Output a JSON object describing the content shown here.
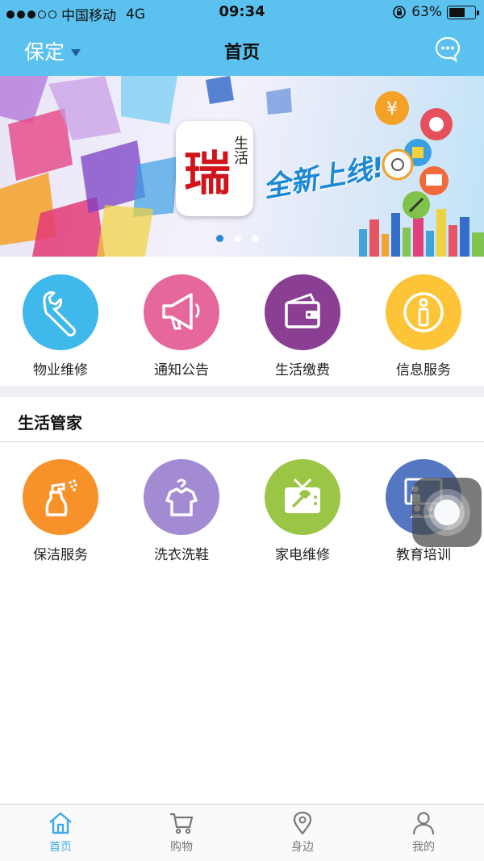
{
  "status_bar": {
    "carrier": "中国移动",
    "network": "4G",
    "time": "09:34",
    "battery": "63%",
    "battery_level": 0.63
  },
  "nav": {
    "city": "保定",
    "title": "首页",
    "chat_icon": "chat-bubble-icon"
  },
  "banner": {
    "logo_main": "瑞",
    "logo_side": "生活",
    "slogan": "全新上线!",
    "pages": 3,
    "active_page": 1
  },
  "services": [
    {
      "label": "物业维修",
      "icon": "wrench-icon",
      "color": "#3fb8ec"
    },
    {
      "label": "通知公告",
      "icon": "megaphone-icon",
      "color": "#e5679b"
    },
    {
      "label": "生活缴费",
      "icon": "wallet-icon",
      "color": "#8a3f93"
    },
    {
      "label": "信息服务",
      "icon": "info-icon",
      "color": "#fcc436"
    }
  ],
  "section": {
    "title": "生活管家"
  },
  "housekeeper": [
    {
      "label": "保洁服务",
      "icon": "spray-bottle-icon",
      "color": "#f7922a"
    },
    {
      "label": "洗衣洗鞋",
      "icon": "shirt-hanger-icon",
      "color": "#a28bd3"
    },
    {
      "label": "家电维修",
      "icon": "tv-repair-icon",
      "color": "#9bc545"
    },
    {
      "label": "教育培训",
      "icon": "classroom-icon",
      "color": "#5576c0"
    }
  ],
  "tabs": [
    {
      "label": "首页",
      "icon": "home-icon",
      "active": true
    },
    {
      "label": "购物",
      "icon": "cart-icon",
      "active": false
    },
    {
      "label": "身边",
      "icon": "location-pin-icon",
      "active": false
    },
    {
      "label": "我的",
      "icon": "user-icon",
      "active": false
    }
  ],
  "colors": {
    "primary": "#5bc1ee",
    "tab_active": "#3da9e8",
    "tab_inactive": "#777777"
  }
}
